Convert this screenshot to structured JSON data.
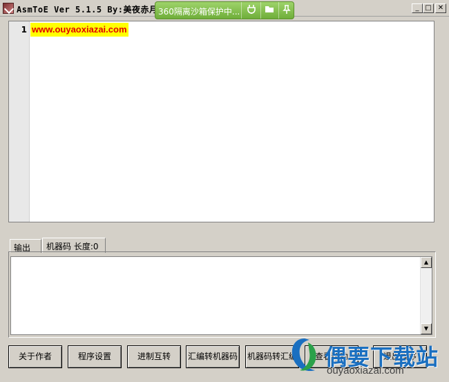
{
  "window": {
    "title": "AsmToE Ver 5.1.5  By:美夜赤月",
    "controls": {
      "minimize": "_",
      "maximize": "□",
      "close": "✕"
    }
  },
  "sandbox": {
    "text": "360隔离沙箱保护中...",
    "icons": [
      "plug-icon",
      "folder-icon",
      "pin-icon"
    ],
    "color": "#7cbf45"
  },
  "editor": {
    "lines": [
      {
        "number": "1",
        "text": "www.ouyaoxiazai.com"
      }
    ],
    "highlight_color": "#ffff00",
    "text_color": "#e00000"
  },
  "tabs": [
    {
      "label": "输出",
      "active": false
    },
    {
      "label": "机器码 长度:0",
      "active": true
    }
  ],
  "output": {
    "value": ""
  },
  "buttons": [
    {
      "label": "关于作者"
    },
    {
      "label": "程序设置"
    },
    {
      "label": "进制互转"
    },
    {
      "label": "汇编转机器码"
    },
    {
      "label": "机器码转汇编"
    },
    {
      "label": "查看帮助"
    },
    {
      "label": "退出程序"
    }
  ],
  "watermark": {
    "text": "偶要下载站",
    "url": "ouyaoxiazai.com"
  }
}
